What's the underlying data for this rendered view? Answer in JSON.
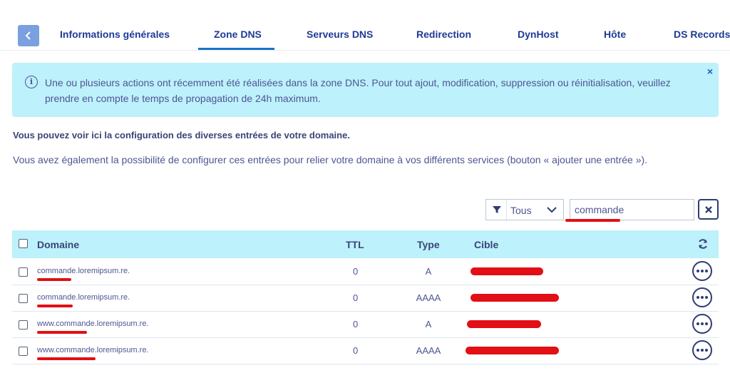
{
  "tabs": [
    {
      "label": "Informations générales",
      "active": false
    },
    {
      "label": "Zone DNS",
      "active": true
    },
    {
      "label": "Serveurs DNS",
      "active": false
    },
    {
      "label": "Redirection",
      "active": false
    },
    {
      "label": "DynHost",
      "active": false
    },
    {
      "label": "Hôte",
      "active": false
    },
    {
      "label": "DS Records",
      "active": false
    }
  ],
  "banner": {
    "text": "Une ou plusieurs actions ont récemment été réalisées dans la zone DNS. Pour tout ajout, modification, suppression ou réinitialisation, veuillez prendre en compte le temps de propagation de 24h maximum.",
    "close": "×",
    "icon": "info-icon"
  },
  "intro": {
    "bold": "Vous pouvez voir ici la configuration des diverses entrées de votre domaine.",
    "text": "Vous avez également la possibilité de configurer ces entrées pour relier votre domaine à vos différents services (bouton « ajouter une entrée »)."
  },
  "filter": {
    "selected": "Tous",
    "search_value": "commande",
    "clear_icon": "close-icon"
  },
  "table": {
    "headers": {
      "domain": "Domaine",
      "ttl": "TTL",
      "type": "Type",
      "target": "Cible"
    },
    "rows": [
      {
        "domain": "commande.loremipsum.re.",
        "ttl": "0",
        "type": "A"
      },
      {
        "domain": "commande.loremipsum.re.",
        "ttl": "0",
        "type": "AAAA"
      },
      {
        "domain": "www.commande.loremipsum.re.",
        "ttl": "0",
        "type": "A"
      },
      {
        "domain": "www.commande.loremipsum.re.",
        "ttl": "0",
        "type": "AAAA"
      }
    ]
  },
  "colors": {
    "accent": "#1d3b96",
    "banner_bg": "#bdf1fb",
    "redaction": "#e20f14"
  }
}
